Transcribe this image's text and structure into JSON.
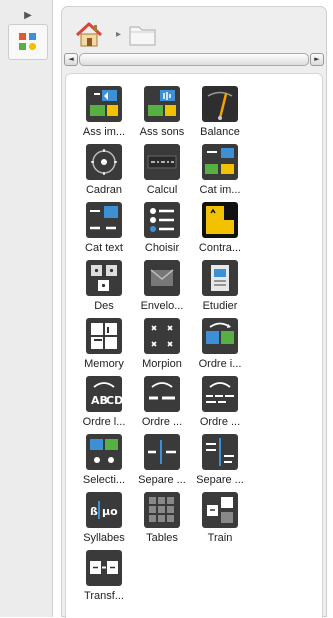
{
  "sidebar": {
    "collapse_icon": "triangle-right-icon",
    "tab_icon": "activities-icon"
  },
  "breadcrumb": {
    "home_icon": "home-icon",
    "separator": "▸",
    "folder_icon": "folder-icon"
  },
  "scrollbar": {
    "left_arrow": "◄",
    "right_arrow": "►"
  },
  "tools": [
    {
      "label": "Ass im...",
      "icon": "associate-images-icon"
    },
    {
      "label": "Ass sons",
      "icon": "associate-sounds-icon"
    },
    {
      "label": "Balance",
      "icon": "balance-icon"
    },
    {
      "label": "Cadran",
      "icon": "clock-dial-icon"
    },
    {
      "label": "Calcul",
      "icon": "calculation-icon"
    },
    {
      "label": "Cat im...",
      "icon": "categorize-images-icon"
    },
    {
      "label": "Cat text",
      "icon": "categorize-text-icon"
    },
    {
      "label": "Choisir",
      "icon": "choose-list-icon"
    },
    {
      "label": "Contra...",
      "icon": "contrast-icon"
    },
    {
      "label": "Des",
      "icon": "dice-icon"
    },
    {
      "label": "Envelo...",
      "icon": "envelope-icon"
    },
    {
      "label": "Etudier",
      "icon": "study-icon"
    },
    {
      "label": "Memory",
      "icon": "memory-icon"
    },
    {
      "label": "Morpion",
      "icon": "tic-tac-toe-icon"
    },
    {
      "label": "Ordre i...",
      "icon": "order-images-icon"
    },
    {
      "label": "Ordre l...",
      "icon": "order-letters-icon"
    },
    {
      "label": "Ordre ...",
      "icon": "order-words-icon"
    },
    {
      "label": "Ordre ...",
      "icon": "order-sentences-icon"
    },
    {
      "label": "Selecti...",
      "icon": "selection-icon"
    },
    {
      "label": "Separe ...",
      "icon": "separate-words-icon"
    },
    {
      "label": "Separe ...",
      "icon": "separate-sentences-icon"
    },
    {
      "label": "Syllabes",
      "icon": "syllables-icon"
    },
    {
      "label": "Tables",
      "icon": "tables-icon"
    },
    {
      "label": "Train",
      "icon": "train-icon"
    },
    {
      "label": "Transf...",
      "icon": "transform-icon"
    }
  ],
  "colors": {
    "tile_dark": "#3a3a3a",
    "accent_blue": "#3d8fd6",
    "accent_yellow": "#f2c200",
    "accent_green": "#57b042",
    "home_red": "#d9473a"
  }
}
